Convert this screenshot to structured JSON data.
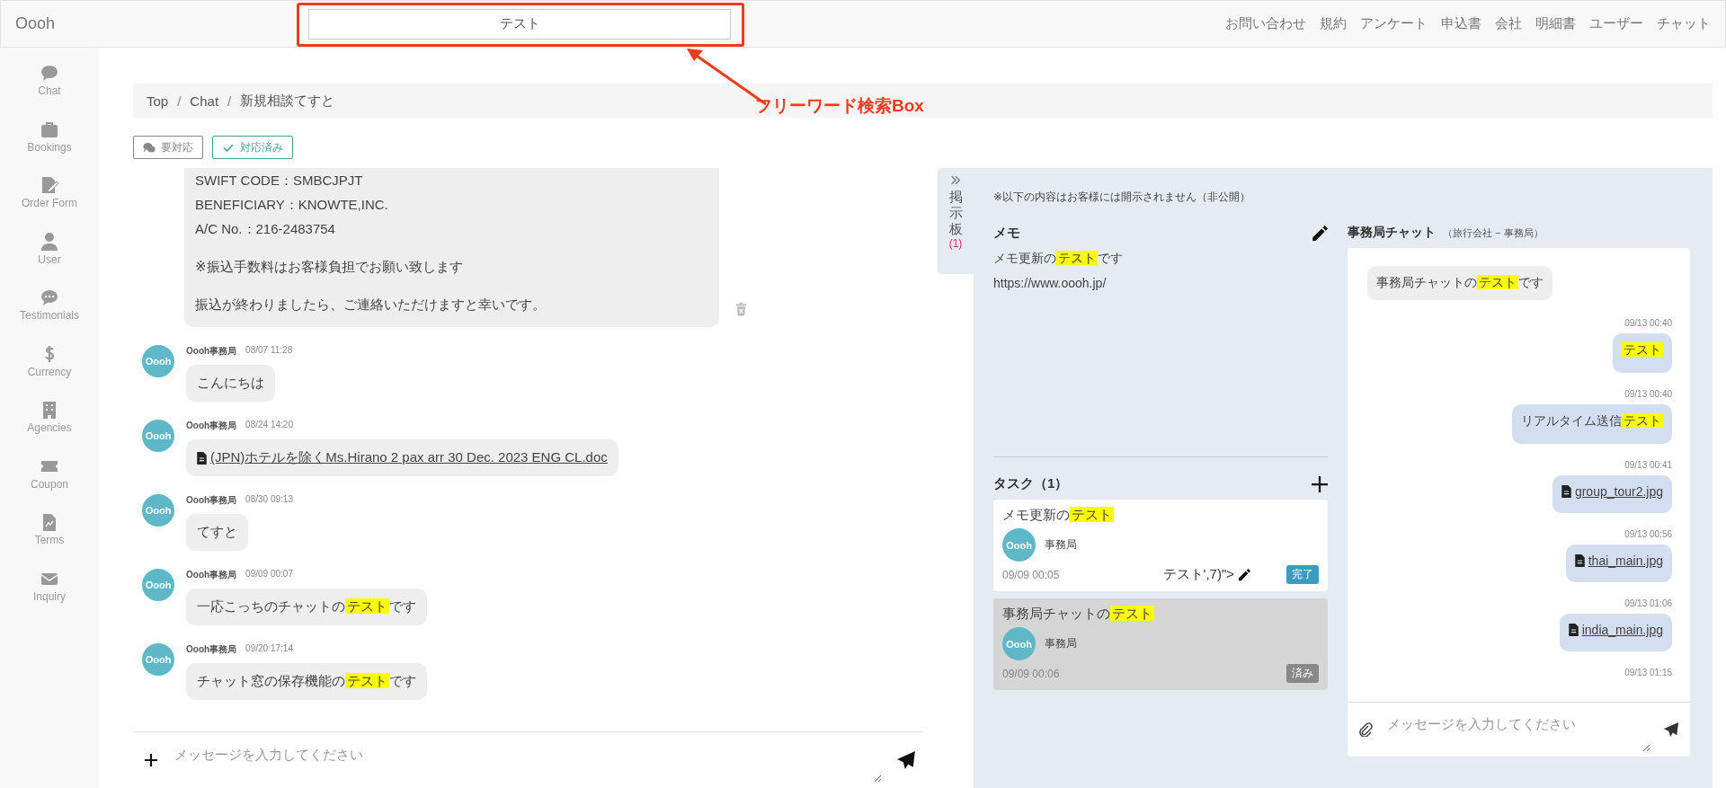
{
  "topbar": {
    "brand": "Oooh",
    "search": {
      "value": "テスト"
    },
    "nav": [
      "お問い合わせ",
      "規約",
      "アンケート",
      "申込書",
      "会社",
      "明細書",
      "ユーザー",
      "チャット"
    ]
  },
  "annotation": {
    "label": "フリーワード検索Box"
  },
  "sidebar": {
    "items": [
      "Chat",
      "Bookings",
      "Order Form",
      "User",
      "Testimonials",
      "Currency",
      "Agencies",
      "Coupon",
      "Terms",
      "Inquiry"
    ]
  },
  "breadcrumb": {
    "separator": "/",
    "items": [
      "Top",
      "Chat",
      "新規相談てすと"
    ]
  },
  "filters": [
    {
      "label": "要対応",
      "selected": false
    },
    {
      "label": "対応済み",
      "selected": true
    }
  ],
  "chat": {
    "first_bubble": [
      [
        "SWIFT CODE：SMBCJPJT",
        "BENEFICIARY：KNOWTE,INC.",
        "A/C No.：216-2483754"
      ],
      [
        "※振込手数料はお客様負担でお願い致します"
      ],
      [
        "振込が終わりましたら、ご連絡いただけますと幸いです。"
      ]
    ],
    "messages": [
      {
        "avatar": "Oooh",
        "sender": "Oooh事務局",
        "time": "08/07 11:28",
        "kind": "text",
        "text": "こんにちは"
      },
      {
        "avatar": "Oooh",
        "sender": "Oooh事務局",
        "time": "08/24 14:20",
        "kind": "file",
        "text": "(JPN)ホテルを除くMs.Hirano 2 pax arr 30 Dec. 2023 ENG CL.doc"
      },
      {
        "avatar": "Oooh",
        "sender": "Oooh事務局",
        "time": "08/30 09:13",
        "kind": "text",
        "text": "てすと"
      },
      {
        "avatar": "Oooh",
        "sender": "Oooh事務局",
        "time": "09/09 00:07",
        "kind": "text",
        "text": "一応こっちのチャットの**テスト**です"
      },
      {
        "avatar": "Oooh",
        "sender": "Oooh事務局",
        "time": "09/20 17:14",
        "kind": "text",
        "text": "チャット窓の保存機能の**テスト**です"
      }
    ],
    "input": {
      "placeholder": "メッセージを入力してください"
    }
  },
  "board": {
    "tab_label": "掲示板",
    "tab_count": "(1)",
    "notice": "※以下の内容はお客様には開示されません（非公開）",
    "memo": {
      "title": "メモ",
      "lines": [
        "メモ更新の**テスト**です",
        "https://www.oooh.jp/"
      ]
    },
    "tasks": {
      "title": "タスク（1）",
      "items": [
        {
          "title": "メモ更新の**テスト**",
          "avatar": "Oooh",
          "assignee": "事務局",
          "date": "09/09 00:05",
          "edit_label": "テスト',7)\">",
          "status": "完了",
          "done": false
        },
        {
          "title": "事務局チャットの**テスト**",
          "avatar": "Oooh",
          "assignee": "事務局",
          "date": "09/09 00:06",
          "status": "済み",
          "done": true
        }
      ]
    },
    "office_chat": {
      "title": "事務局チャット",
      "subtitle": "（旅行会社 − 事務局）",
      "messages": [
        {
          "outgoing": false,
          "kind": "text",
          "text": "事務局チャットの**テスト**です"
        },
        {
          "outgoing": true,
          "time": "09/13 00:40",
          "kind": "text",
          "text": "**テスト**"
        },
        {
          "outgoing": true,
          "time": "09/13 00:40",
          "kind": "text",
          "text": "リアルタイム送信**テスト**"
        },
        {
          "outgoing": true,
          "time": "09/13 00:41",
          "kind": "file",
          "text": "group_tour2.jpg"
        },
        {
          "outgoing": true,
          "time": "09/13 00:56",
          "kind": "file",
          "text": "thai_main.jpg"
        },
        {
          "outgoing": true,
          "time": "09/13 01:06",
          "kind": "file",
          "text": "india_main.jpg"
        },
        {
          "outgoing": true,
          "time": "09/13 01:15",
          "kind": "time_only"
        }
      ],
      "input": {
        "placeholder": "メッセージを入力してください"
      }
    }
  }
}
